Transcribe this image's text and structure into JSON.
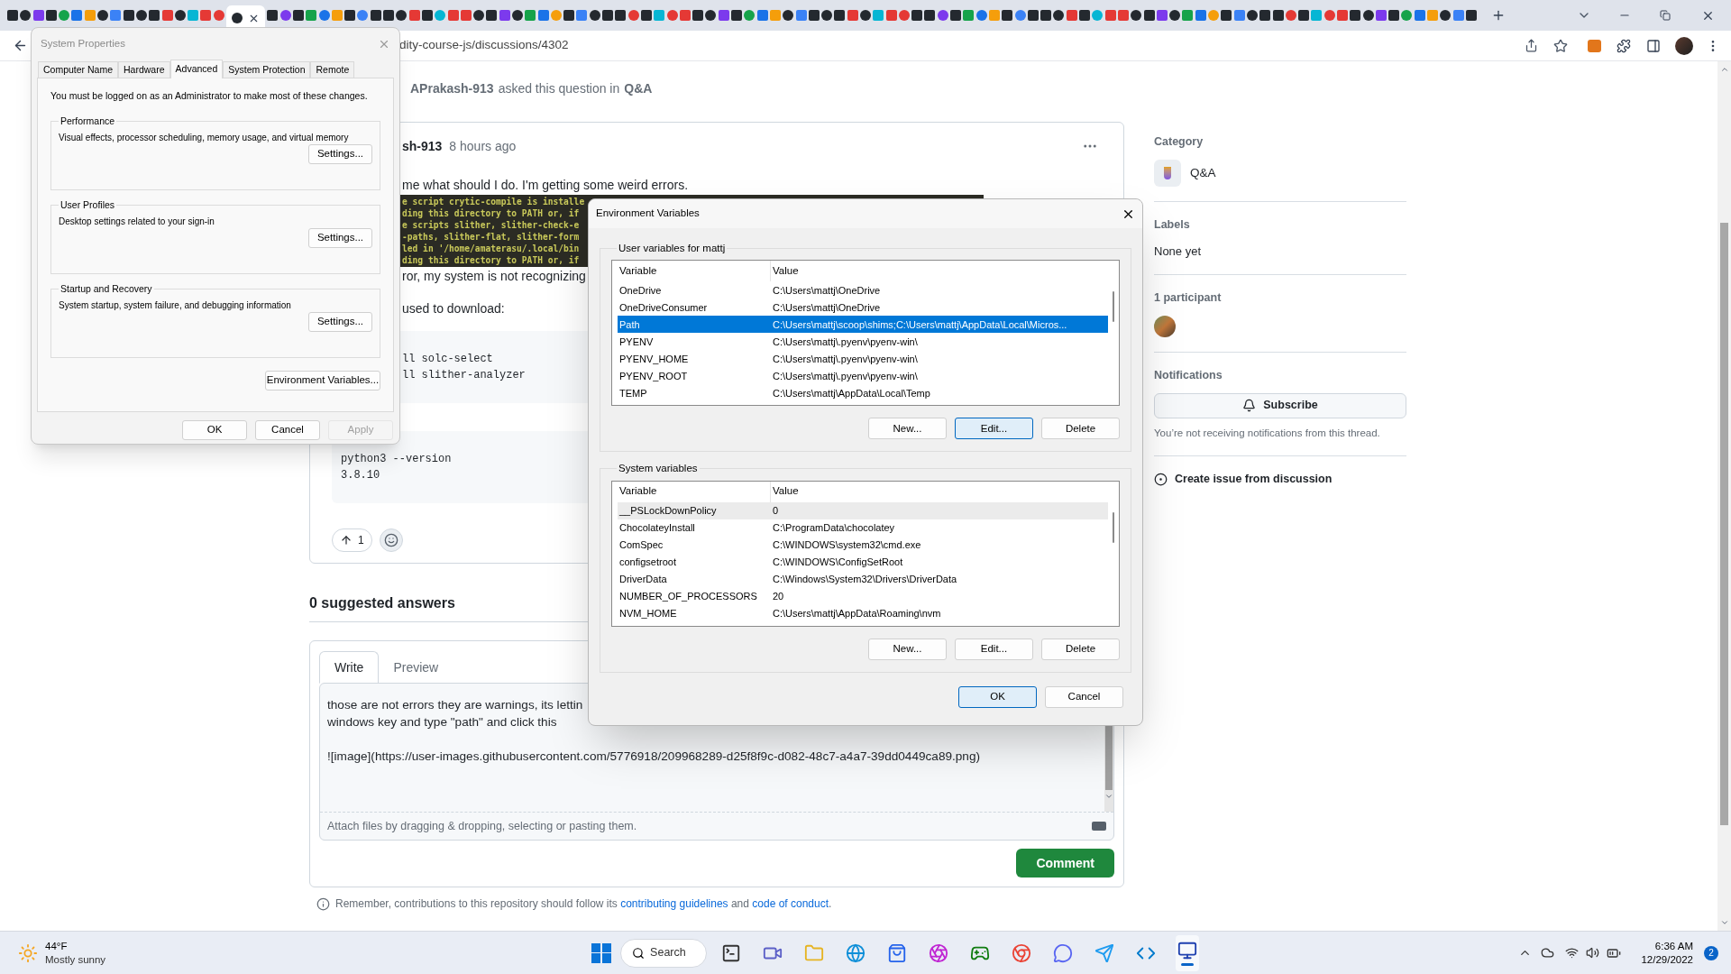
{
  "address_bar": {
    "url": "dity-course-js/discussions/4302"
  },
  "discussion": {
    "asked": {
      "author": "APrakash-913",
      "text": "asked this question in",
      "category": "Q&A"
    },
    "post": {
      "author": "sh-913",
      "time": "8 hours ago",
      "body": [
        {
          "kind": "text",
          "lines": [
            "me what should I do. I'm getting some weird errors."
          ]
        },
        {
          "kind": "terminal",
          "lines": [
            "e script crytic-compile is installe",
            "ding this directory to PATH or, if",
            "e scripts slither, slither-check-e",
            "-paths, slither-flat, slither-form",
            "led in '/home/amaterasu/.local/bin",
            "ding this directory to PATH or, if"
          ]
        },
        {
          "kind": "text",
          "lines": [
            "ror, my system is not recognizing"
          ]
        },
        {
          "kind": "text",
          "lines": [
            "used to download:"
          ]
        },
        {
          "kind": "code",
          "lines": [
            "ll solc-select",
            "ll slither-analyzer"
          ]
        },
        {
          "kind": "code",
          "lines": [
            "python3 --version",
            "3.8.10"
          ]
        }
      ],
      "upvotes": "1"
    },
    "answers_heading": "0 suggested answers",
    "composer": {
      "tabs": [
        {
          "label": "Write",
          "selected": true
        },
        {
          "label": "Preview",
          "selected": false
        }
      ],
      "value": "those are not errors they are warnings, its lettin\nwindows key and type \"path\" and click this\n\n![image](https://user-images.githubusercontent.com/5776918/209968289-d25f8f9c-d082-48c7-a4a7-39dd0449ca89.png)",
      "attach_hint": "Attach files by dragging & dropping, selecting or pasting them.",
      "submit": "Comment"
    },
    "footer_note": {
      "before": "Remember, contributions to this repository should follow its",
      "link1": "contributing guidelines",
      "middle": "and",
      "link2": "code of conduct",
      "after": "."
    }
  },
  "sidebar": {
    "sections": [
      {
        "kind": "category",
        "heading": "Category",
        "value": "Q&A"
      },
      {
        "kind": "text",
        "heading": "Labels",
        "value": "None yet"
      },
      {
        "kind": "participants",
        "heading": "1 participant"
      },
      {
        "kind": "notifications",
        "heading": "Notifications",
        "button": "Subscribe",
        "note": "You’re not receiving notifications from this thread."
      }
    ],
    "action": "Create issue from discussion"
  },
  "system_properties": {
    "title": "System Properties",
    "tabs": [
      {
        "label": "Computer Name",
        "selected": false
      },
      {
        "label": "Hardware",
        "selected": false
      },
      {
        "label": "Advanced",
        "selected": true
      },
      {
        "label": "System Protection",
        "selected": false
      },
      {
        "label": "Remote",
        "selected": false
      }
    ],
    "notice": "You must be logged on as an Administrator to make most of these changes.",
    "groups": [
      {
        "title": "Performance",
        "description": "Visual effects, processor scheduling, memory usage, and virtual memory",
        "button": "Settings..."
      },
      {
        "title": "User Profiles",
        "description": "Desktop settings related to your sign-in",
        "button": "Settings..."
      },
      {
        "title": "Startup and Recovery",
        "description": "System startup, system failure, and debugging information",
        "button": "Settings..."
      }
    ],
    "env_button": "Environment Variables...",
    "buttons": [
      {
        "label": "OK",
        "disabled": false
      },
      {
        "label": "Cancel",
        "disabled": false
      },
      {
        "label": "Apply",
        "disabled": true
      }
    ]
  },
  "environment_variables": {
    "title": "Environment Variables",
    "lists": [
      {
        "title": "User variables for mattj",
        "focused": true,
        "columns": [
          "Variable",
          "Value"
        ],
        "rows": [
          {
            "name": "OneDrive",
            "value": "C:\\Users\\mattj\\OneDrive",
            "selected": false
          },
          {
            "name": "OneDriveConsumer",
            "value": "C:\\Users\\mattj\\OneDrive",
            "selected": false
          },
          {
            "name": "Path",
            "value": "C:\\Users\\mattj\\scoop\\shims;C:\\Users\\mattj\\AppData\\Local\\Micros...",
            "selected": true
          },
          {
            "name": "PYENV",
            "value": "C:\\Users\\mattj\\.pyenv\\pyenv-win\\",
            "selected": false
          },
          {
            "name": "PYENV_HOME",
            "value": "C:\\Users\\mattj\\.pyenv\\pyenv-win\\",
            "selected": false
          },
          {
            "name": "PYENV_ROOT",
            "value": "C:\\Users\\mattj\\.pyenv\\pyenv-win\\",
            "selected": false
          },
          {
            "name": "TEMP",
            "value": "C:\\Users\\mattj\\AppData\\Local\\Temp",
            "selected": false
          }
        ],
        "buttons": [
          {
            "label": "New...",
            "focused": false
          },
          {
            "label": "Edit...",
            "focused": true
          },
          {
            "label": "Delete",
            "focused": false
          }
        ]
      },
      {
        "title": "System variables",
        "focused": false,
        "columns": [
          "Variable",
          "Value"
        ],
        "rows": [
          {
            "name": "__PSLockDownPolicy",
            "value": "0",
            "selected": true
          },
          {
            "name": "ChocolateyInstall",
            "value": "C:\\ProgramData\\chocolatey",
            "selected": false
          },
          {
            "name": "ComSpec",
            "value": "C:\\WINDOWS\\system32\\cmd.exe",
            "selected": false
          },
          {
            "name": "configsetroot",
            "value": "C:\\WINDOWS\\ConfigSetRoot",
            "selected": false
          },
          {
            "name": "DriverData",
            "value": "C:\\Windows\\System32\\Drivers\\DriverData",
            "selected": false
          },
          {
            "name": "NUMBER_OF_PROCESSORS",
            "value": "20",
            "selected": false
          },
          {
            "name": "NVM_HOME",
            "value": "C:\\Users\\mattj\\AppData\\Roaming\\nvm",
            "selected": false
          }
        ],
        "buttons": [
          {
            "label": "New...",
            "focused": false
          },
          {
            "label": "Edit...",
            "focused": false
          },
          {
            "label": "Delete",
            "focused": false
          }
        ]
      }
    ],
    "buttons": [
      {
        "label": "OK",
        "focused": true
      },
      {
        "label": "Cancel",
        "focused": false
      }
    ]
  },
  "taskbar": {
    "weather": {
      "temperature": "44°F",
      "condition": "Mostly sunny"
    },
    "search": "Search",
    "time": "6:36 AM",
    "date": "12/29/2022",
    "notification_count": "2"
  }
}
